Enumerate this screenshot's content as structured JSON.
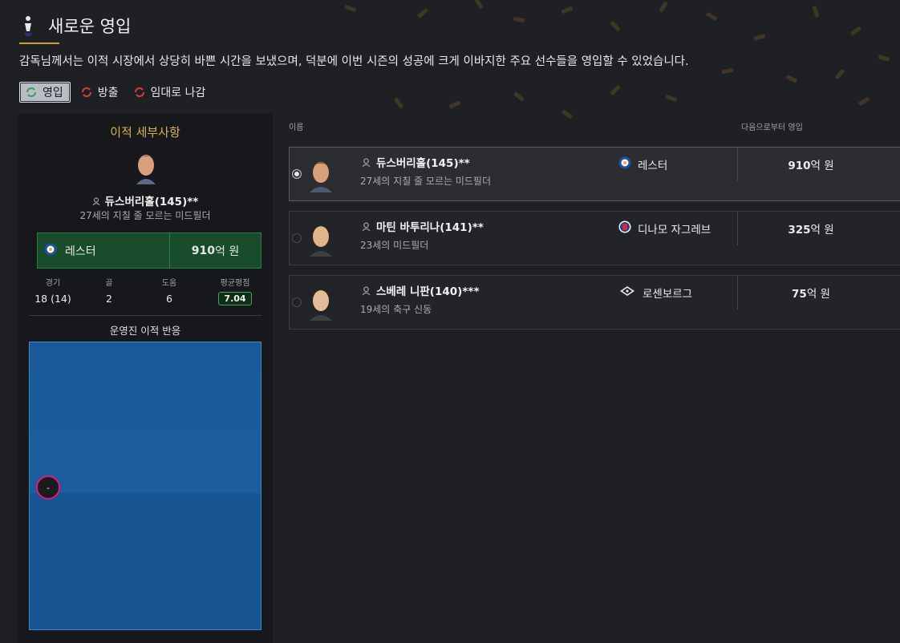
{
  "header": {
    "title": "새로운 영입"
  },
  "description": "감독님께서는 이적 시장에서 상당히 바쁜 시간을 보냈으며, 덕분에 이번 시즌의 성공에 크게 이바지한 주요 선수들을 영입할 수 있었습니다.",
  "filters": [
    {
      "label": "영입",
      "icon": "transfer-in-icon",
      "active": true
    },
    {
      "label": "방출",
      "icon": "transfer-out-icon",
      "active": false
    },
    {
      "label": "임대로 나감",
      "icon": "loan-out-icon",
      "active": false
    }
  ],
  "detail": {
    "title": "이적 세부사항",
    "player_name": "듀스버리홀(145)**",
    "player_desc": "27세의 지칠 줄 모르는 미드필더",
    "club": "레스터",
    "fee_amount": "910",
    "fee_unit": "억 원",
    "stats": {
      "games_label": "경기",
      "games_value": "18 (14)",
      "goals_label": "골",
      "goals_value": "2",
      "assists_label": "도움",
      "assists_value": "6",
      "rating_label": "평균평점",
      "rating_value": "7.04"
    },
    "reaction_title": "운영진 이적 반응",
    "reaction_marker": "-"
  },
  "list": {
    "col_name": "이름",
    "col_from": "다음으로부터 영입",
    "rows": [
      {
        "name": "듀스버리홀(145)**",
        "desc": "27세의 지칠 줄 모르는 미드필더",
        "club": "레스터",
        "fee_amount": "910",
        "fee_unit": "억 원",
        "selected": true
      },
      {
        "name": "마틴 바투리나(141)**",
        "desc": "23세의 미드필더",
        "club": "디나모 자그레브",
        "fee_amount": "325",
        "fee_unit": "억 원",
        "selected": false
      },
      {
        "name": "스베레 니판(140)***",
        "desc": "19세의 축구 신동",
        "club": "로센보르그",
        "fee_amount": "75",
        "fee_unit": "억 원",
        "selected": false
      }
    ]
  },
  "colors": {
    "accent_gold": "#d8b24a",
    "positive_green": "#184c2b",
    "reaction_blue": "#1a5a99",
    "marker_pink": "#e4167c"
  }
}
